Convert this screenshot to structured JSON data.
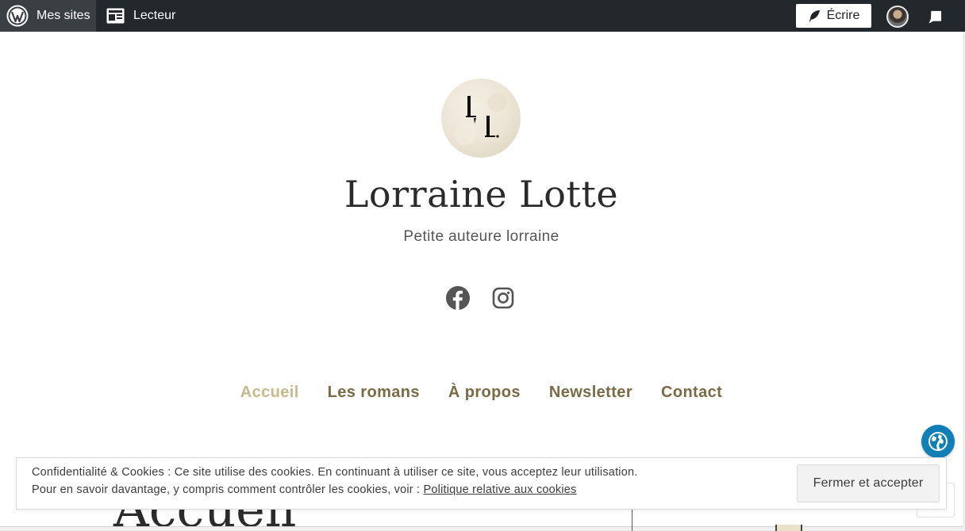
{
  "adminbar": {
    "my_sites": "Mes sites",
    "reader": "Lecteur",
    "write": "Écrire"
  },
  "site": {
    "title": "Lorraine Lotte",
    "tagline": "Petite auteure lorraine"
  },
  "social": [
    "facebook-icon",
    "instagram-icon"
  ],
  "nav": {
    "items": [
      "Accueil",
      "Les romans",
      "À propos",
      "Newsletter",
      "Contact"
    ],
    "current": "Accueil"
  },
  "page": {
    "title": "Accueil"
  },
  "cookie": {
    "line1": "Confidentialité & Cookies : Ce site utilise des cookies. En continuant à utiliser ce site, vous acceptez leur utilisation.",
    "line2_prefix": "Pour en savoir davantage, y compris comment contrôler les cookies, voir : ",
    "link": "Politique relative aux cookies",
    "button": "Fermer et accepter"
  },
  "colors": {
    "adminbar": "#23282d",
    "nav_link": "#7a6a45",
    "nav_current": "#c9b88a",
    "globe": "#0f7fb6"
  }
}
